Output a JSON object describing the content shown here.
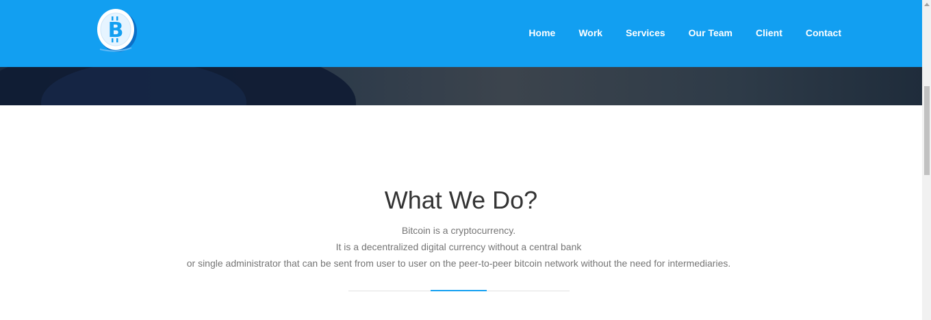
{
  "colors": {
    "navbar_bg": "#129ff1",
    "accent": "#129ff1",
    "title": "#333333",
    "body_text": "#757575"
  },
  "logo": {
    "icon": "bitcoin-icon",
    "glyph": "B"
  },
  "nav": {
    "items": [
      {
        "label": "Home"
      },
      {
        "label": "Work"
      },
      {
        "label": "Services"
      },
      {
        "label": "Our Team"
      },
      {
        "label": "Client"
      },
      {
        "label": "Contact"
      }
    ]
  },
  "section": {
    "title": "What We Do?",
    "lines": [
      "Bitcoin is a cryptocurrency.",
      "It is a decentralized digital currency without a central bank",
      "or single administrator that can be sent from user to user on the peer-to-peer bitcoin network without the need for intermediaries."
    ]
  }
}
